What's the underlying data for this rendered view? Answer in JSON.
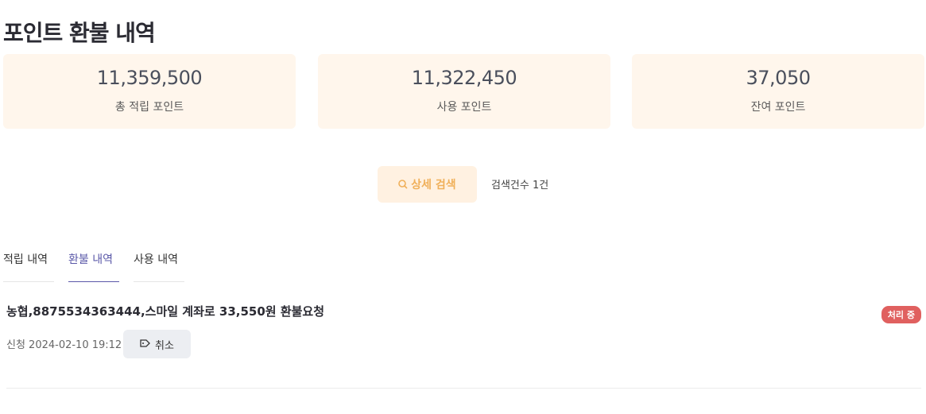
{
  "page": {
    "title": "포인트 환불 내역"
  },
  "summary": [
    {
      "value": "11,359,500",
      "label": "총 적립 포인트"
    },
    {
      "value": "11,322,450",
      "label": "사용 포인트"
    },
    {
      "value": "37,050",
      "label": "잔여 포인트"
    }
  ],
  "search": {
    "button_label": "상세 검색",
    "result_count": "검색건수 1건"
  },
  "tabs": [
    {
      "label": "적립 내역"
    },
    {
      "label": "환불 내역"
    },
    {
      "label": "사용 내역"
    }
  ],
  "refund_item": {
    "title": "농협,8875534363444,스마일 계좌로 33,550원 환불요청",
    "status": "처리 중",
    "date": "신청 2024-02-10 19:12",
    "cancel_label": "취소"
  },
  "colors": {
    "accent": "#f0b05a",
    "tab_active": "#5a58a8",
    "status": "#e0605f",
    "card_bg": "#fff6ec"
  }
}
